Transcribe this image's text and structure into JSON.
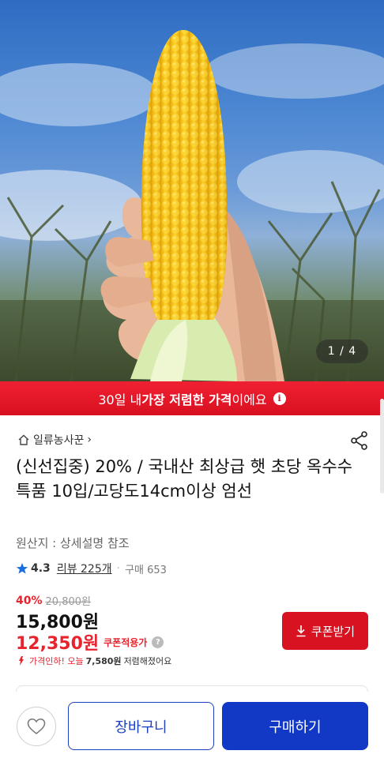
{
  "hero": {
    "image_subject": "Hand holding a yellow corn cob against blue sky",
    "page_indicator": "1 / 4"
  },
  "banner": {
    "prefix": "30일 내 ",
    "highlight": "가장 저렴한 가격",
    "suffix": "이에요",
    "info_icon": "i"
  },
  "seller": {
    "name": "일류농사꾼",
    "chevron": "›"
  },
  "product": {
    "title": "(신선집중) 20% / 국내산 최상급 햇 초당 옥수수 특품 10입/고당도14cm이상 엄선",
    "origin": "원산지 : 상세설명 참조",
    "rating": "4.3",
    "reviews": "리뷰 225개",
    "separator": "·",
    "sales": "구매 653"
  },
  "pricing": {
    "discount_rate": "40%",
    "original_price": "20,800원",
    "price": "15,800원",
    "coupon_price": "12,350원",
    "coupon_label": "쿠폰적용가",
    "help_icon": "?",
    "price_drop_prefix": "가격인하! 오늘 ",
    "price_drop_amount": "7,580원",
    "price_drop_suffix": " 저렴해졌어요"
  },
  "buttons": {
    "coupon": "쿠폰받기",
    "cart": "장바구니",
    "buy": "구매하기"
  },
  "colors": {
    "accent_red": "#d81220",
    "accent_blue": "#1238c6",
    "star_blue": "#1a6fe0"
  },
  "icons": [
    "home-icon",
    "share-icon",
    "star-icon",
    "download-icon",
    "heart-icon",
    "info-icon",
    "help-icon",
    "arrow-down-icon"
  ]
}
